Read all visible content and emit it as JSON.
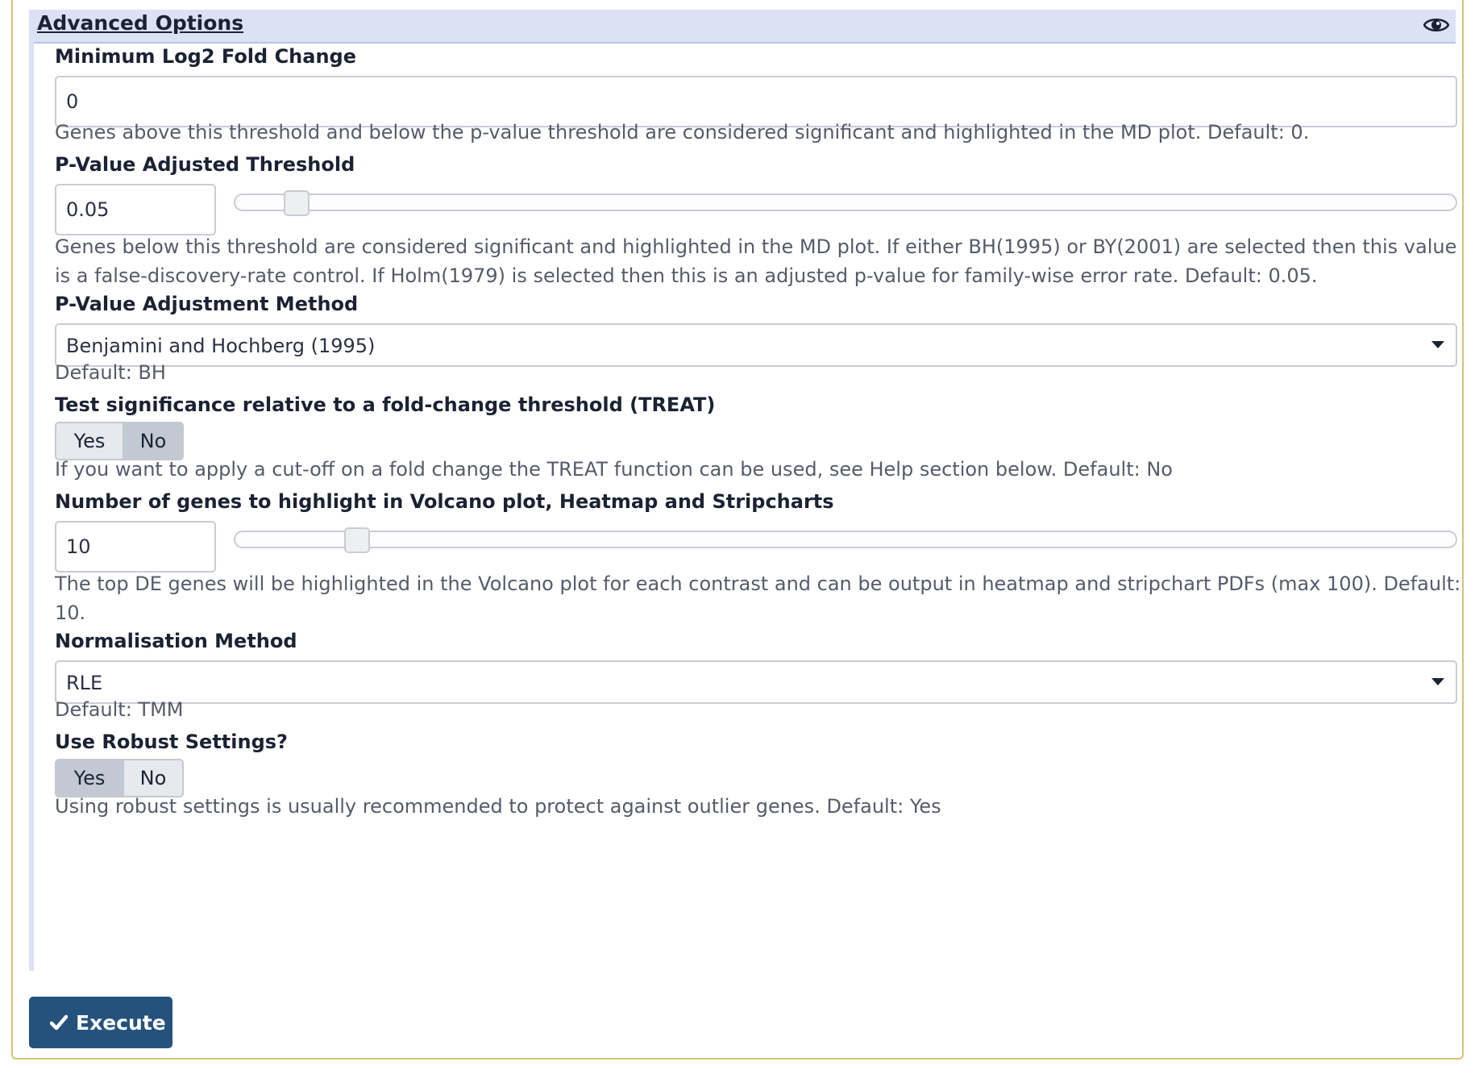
{
  "section": {
    "title": "Advanced Options",
    "toggle_icon": "eye-icon"
  },
  "log2fc": {
    "label": "Minimum Log2 Fold Change",
    "value": "0",
    "help": "Genes above this threshold and below the p-value threshold are considered significant and highlighted in the MD plot. Default: 0."
  },
  "pvalue": {
    "label": "P-Value Adjusted Threshold",
    "value": "0.05",
    "slider_fraction": 0.05,
    "help": "Genes below this threshold are considered significant and highlighted in the MD plot. If either BH(1995) or BY(2001) are selected then this value is a false-discovery-rate control. If Holm(1979) is selected then this is an adjusted p-value for family-wise error rate. Default: 0.05."
  },
  "adjust_method": {
    "label": "P-Value Adjustment Method",
    "selected": "Benjamini and Hochberg (1995)",
    "help": "Default: BH"
  },
  "treat": {
    "label": "Test significance relative to a fold-change threshold (TREAT)",
    "yes": "Yes",
    "no": "No",
    "selected": "No",
    "help": "If you want to apply a cut-off on a fold change the TREAT function can be used, see Help section below. Default: No"
  },
  "top_genes": {
    "label": "Number of genes to highlight in Volcano plot, Heatmap and Stripcharts",
    "value": "10",
    "slider_fraction": 0.1,
    "help": "The top DE genes will be highlighted in the Volcano plot for each contrast and can be output in heatmap and stripchart PDFs (max 100). Default: 10."
  },
  "norm_method": {
    "label": "Normalisation Method",
    "selected": "RLE",
    "help": "Default: TMM"
  },
  "robust": {
    "label": "Use Robust Settings?",
    "yes": "Yes",
    "no": "No",
    "selected": "Yes",
    "help": "Using robust settings is usually recommended to protect against outlier genes. Default: Yes"
  },
  "execute": {
    "label": "Execute",
    "icon": "check-icon"
  },
  "colors": {
    "header_bg": "#dbe2f4",
    "execute_bg": "#25527c",
    "frame_border": "#d8c07a",
    "toggle_active": "#c3c9d3"
  }
}
